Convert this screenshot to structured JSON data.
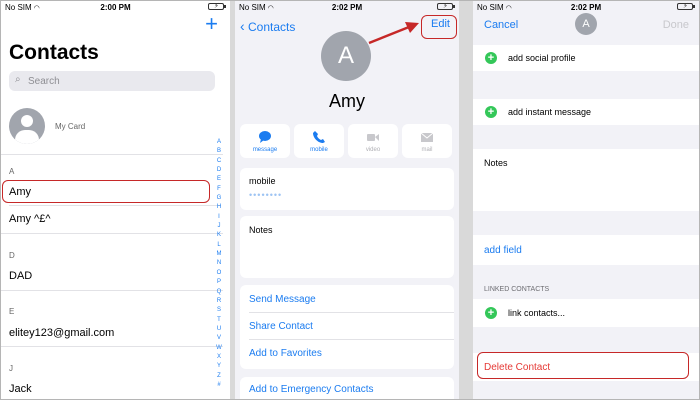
{
  "status": {
    "carrier": "No SIM",
    "times": [
      "2:00 PM",
      "2:02 PM",
      "2:02 PM"
    ]
  },
  "contacts_list": {
    "title": "Contacts",
    "search_placeholder": "Search",
    "my_card": "My Card",
    "sections": [
      {
        "letter": "A",
        "names": [
          "Amy",
          "Amy ^£^"
        ]
      },
      {
        "letter": "D",
        "names": [
          "DAD"
        ]
      },
      {
        "letter": "E",
        "names": [
          "elitey123@gmail.com"
        ]
      },
      {
        "letter": "J",
        "names": [
          "Jack"
        ]
      }
    ],
    "index": [
      "A",
      "B",
      "C",
      "D",
      "E",
      "F",
      "G",
      "H",
      "I",
      "J",
      "K",
      "L",
      "M",
      "N",
      "O",
      "P",
      "Q",
      "R",
      "S",
      "T",
      "U",
      "V",
      "W",
      "X",
      "Y",
      "Z",
      "#"
    ]
  },
  "contact_detail": {
    "back_label": "Contacts",
    "edit_label": "Edit",
    "avatar_initial": "A",
    "name": "Amy",
    "actions": [
      "message",
      "mobile",
      "video",
      "mail"
    ],
    "phone_label": "mobile",
    "phone_value": "••••••••",
    "notes_label": "Notes",
    "links": [
      "Send Message",
      "Share Contact",
      "Add to Favorites"
    ],
    "emergency": "Add to Emergency Contacts"
  },
  "edit_contact": {
    "cancel_label": "Cancel",
    "done_label": "Done",
    "avatar_initial": "A",
    "add_social": "add social profile",
    "add_im": "add instant message",
    "notes_label": "Notes",
    "add_field": "add field",
    "linked_header": "LINKED CONTACTS",
    "link_contacts": "link contacts...",
    "delete_label": "Delete Contact"
  },
  "colors": {
    "accent": "#1b7cf0",
    "destructive": "#e53935",
    "highlight": "#c62828",
    "add_green": "#34c759"
  }
}
